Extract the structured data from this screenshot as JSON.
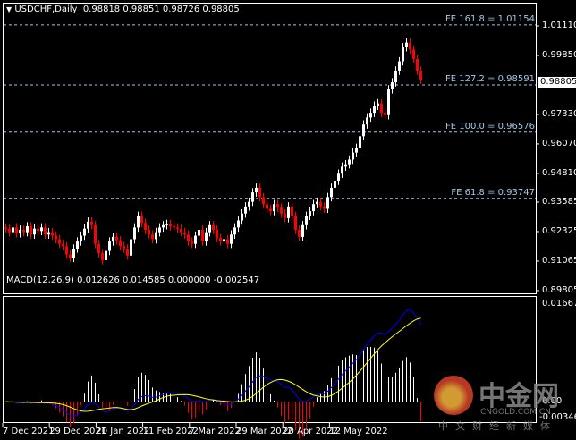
{
  "header": {
    "symbol": "USDCHF,Daily",
    "ohlc": "0.98818 0.98851 0.98726 0.98805"
  },
  "current_price": "0.98805",
  "price_axis": [
    "1.01110",
    "0.99850",
    "0.97330",
    "0.96070",
    "0.94810",
    "0.93585",
    "0.92325",
    "0.91065",
    "0.89805"
  ],
  "fib_levels": [
    {
      "label": "FE 161.8 = 1.01154",
      "value": 1.01154
    },
    {
      "label": "FE 127.2 = 0.98591",
      "value": 0.98591
    },
    {
      "label": "FE 100.0 = 0.96576",
      "value": 0.96576
    },
    {
      "label": "FE 61.8 = 0.93747",
      "value": 0.93747
    }
  ],
  "macd": {
    "label": "MACD(12,26,9) 0.012626 0.014585 0.000000 -0.002547",
    "axis": [
      "0.016673",
      "0.00",
      "-0.003462"
    ]
  },
  "dates": [
    "7 Dec 2021",
    "29 Dec 2021",
    "20 Jan 2022",
    "11 Feb 2022",
    "7 Mar 2022",
    "29 Mar 2022",
    "20 Apr 2022",
    "12 May 2022"
  ],
  "colors": {
    "bull": "#ffffff",
    "bear": "#ff0000",
    "fib": "#9fc9e6",
    "macd_main": "#0000ff",
    "macd_signal": "#ffff00"
  },
  "watermark": {
    "brand": "中金网",
    "domain": "CNGOLD.COM.CN",
    "tagline": "中文财经新媒体"
  },
  "chart_data": {
    "type": "candlestick",
    "ylim": [
      0.89805,
      1.0111
    ],
    "closes": [
      0.9245,
      0.923,
      0.925,
      0.9225,
      0.924,
      0.923,
      0.9255,
      0.922,
      0.9245,
      0.9235,
      0.925,
      0.922,
      0.923,
      0.9215,
      0.92,
      0.918,
      0.917,
      0.9135,
      0.912,
      0.916,
      0.919,
      0.9215,
      0.9245,
      0.9275,
      0.926,
      0.918,
      0.914,
      0.911,
      0.915,
      0.919,
      0.921,
      0.9195,
      0.917,
      0.916,
      0.913,
      0.92,
      0.925,
      0.93,
      0.927,
      0.924,
      0.922,
      0.92,
      0.923,
      0.925,
      0.926,
      0.9265,
      0.9255,
      0.925,
      0.9245,
      0.923,
      0.922,
      0.919,
      0.918,
      0.9215,
      0.924,
      0.919,
      0.923,
      0.926,
      0.924,
      0.9205,
      0.919,
      0.92,
      0.918,
      0.922,
      0.925,
      0.928,
      0.931,
      0.934,
      0.936,
      0.94,
      0.942,
      0.938,
      0.935,
      0.933,
      0.932,
      0.935,
      0.9335,
      0.931,
      0.929,
      0.934,
      0.93,
      0.924,
      0.921,
      0.926,
      0.93,
      0.932,
      0.935,
      0.936,
      0.934,
      0.933,
      0.938,
      0.942,
      0.945,
      0.948,
      0.951,
      0.952,
      0.954,
      0.957,
      0.959,
      0.964,
      0.969,
      0.972,
      0.974,
      0.977,
      0.978,
      0.974,
      0.973,
      0.984,
      0.987,
      0.992,
      0.996,
      1.002,
      1.004,
      1.001,
      0.997,
      0.992,
      0.98805
    ]
  }
}
